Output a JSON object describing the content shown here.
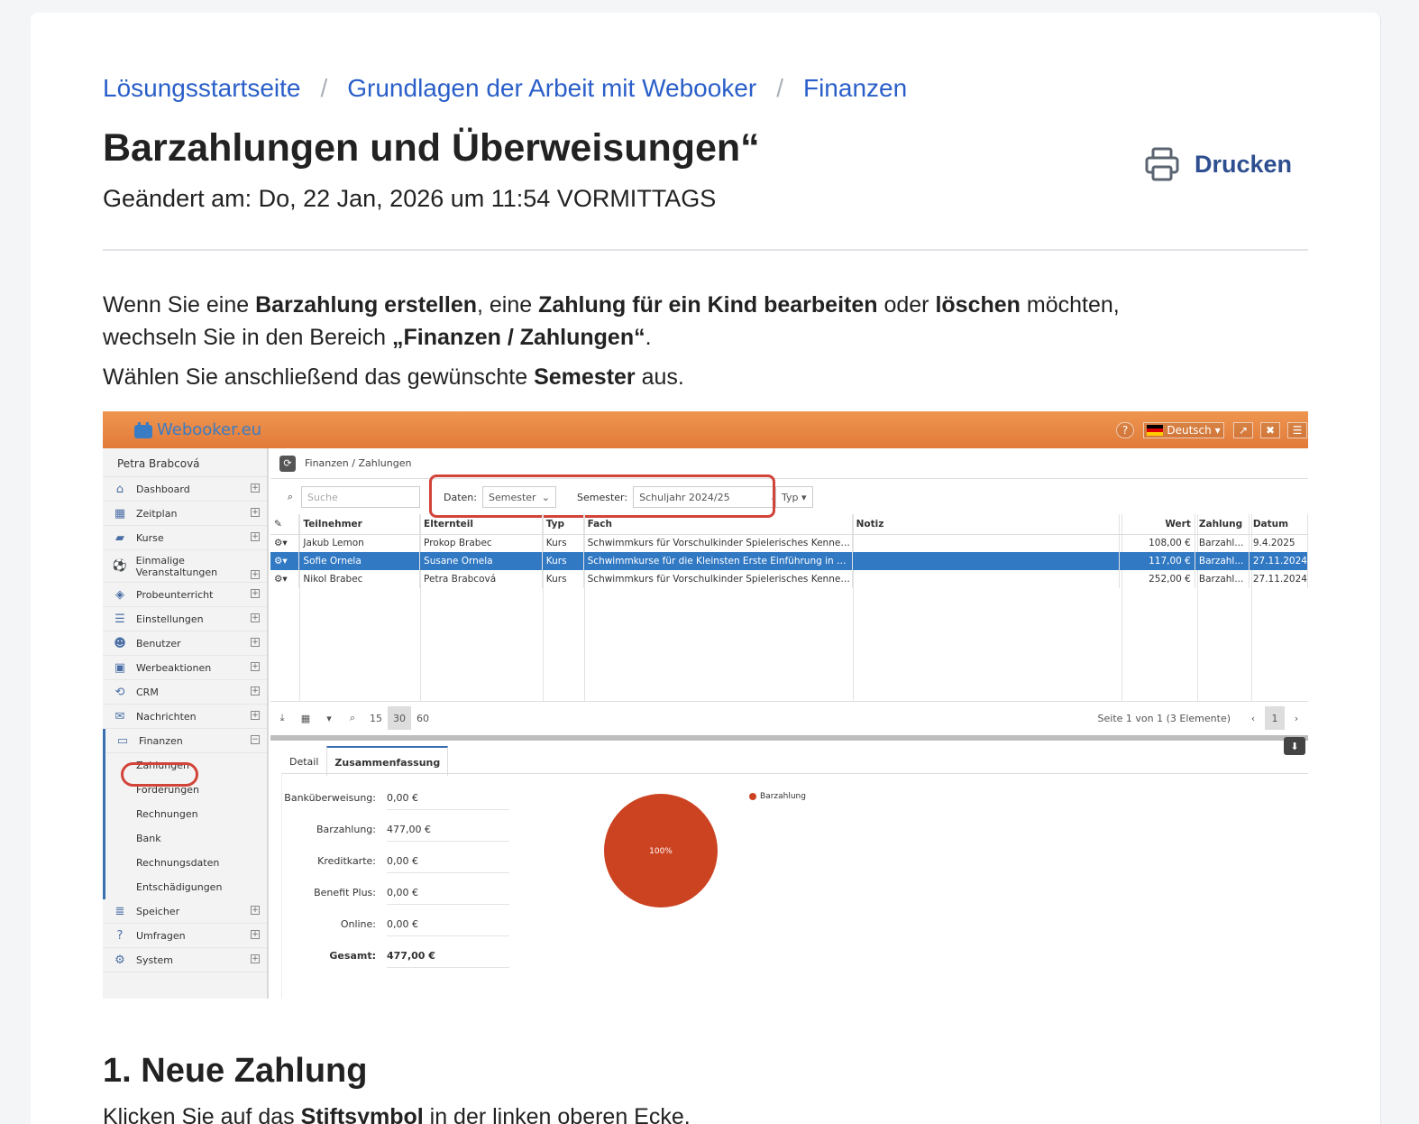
{
  "breadcrumbs": [
    "Lösungsstartseite",
    "Grundlagen der Arbeit mit Webooker",
    "Finanzen"
  ],
  "breadcrumb_separator": "/",
  "title": "Barzahlungen und Überweisungen“",
  "modified": "Geändert am: Do, 22 Jan, 2026 um 11:54 VORMITTAGS",
  "print_label": "Drucken",
  "intro": {
    "p1_a": "Wenn Sie eine ",
    "p1_b": "Barzahlung erstellen",
    "p1_c": ", eine ",
    "p1_d": "Zahlung für ein Kind bearbeiten",
    "p1_e": " oder ",
    "p1_f": "löschen",
    "p1_g": " möchten,",
    "p2_a": "wechseln Sie in den Bereich ",
    "p2_b": "„Finanzen / Zahlungen“",
    "p2_c": ".",
    "p3_a": "Wählen Sie anschließend das gewünschte ",
    "p3_b": "Semester",
    "p3_c": " aus."
  },
  "section_heading": "1. Neue Zahlung",
  "section_text_a": "Klicken Sie auf das ",
  "section_text_b": "Stiftsymbol",
  "section_text_c": " in der linken oberen Ecke.",
  "screenshot": {
    "logo": "Webooker.eu",
    "language": "Deutsch",
    "user": "Petra Brabcová",
    "nav": [
      {
        "label": "Dashboard",
        "icon": "home-icon",
        "glyph": "⌂"
      },
      {
        "label": "Zeitplan",
        "icon": "calendar-icon",
        "glyph": "▦"
      },
      {
        "label": "Kurse",
        "icon": "book-icon",
        "glyph": "▰"
      },
      {
        "label": "Einmalige Veranstaltungen",
        "icon": "soccer-icon",
        "glyph": "⚽"
      },
      {
        "label": "Probeunterricht",
        "icon": "eye-icon",
        "glyph": "◈"
      },
      {
        "label": "Einstellungen",
        "icon": "list-icon",
        "glyph": "☰"
      },
      {
        "label": "Benutzer",
        "icon": "users-icon",
        "glyph": "☻"
      },
      {
        "label": "Werbeaktionen",
        "icon": "gift-icon",
        "glyph": "▣"
      },
      {
        "label": "CRM",
        "icon": "handshake-icon",
        "glyph": "⟲"
      },
      {
        "label": "Nachrichten",
        "icon": "envelope-icon",
        "glyph": "✉"
      },
      {
        "label": "Finanzen",
        "icon": "money-icon",
        "glyph": "▭"
      }
    ],
    "finance_sub": [
      "Zahlungen",
      "Forderungen",
      "Rechnungen",
      "Bank",
      "Rechnungsdaten",
      "Entschädigungen"
    ],
    "nav_bottom": [
      {
        "label": "Speicher",
        "icon": "database-icon",
        "glyph": "≣"
      },
      {
        "label": "Umfragen",
        "icon": "question-icon",
        "glyph": "?"
      },
      {
        "label": "System",
        "icon": "cogs-icon",
        "glyph": "⚙"
      }
    ],
    "header_path": "Finanzen / Zahlungen",
    "search_placeholder": "Suche",
    "daten_label": "Daten:",
    "daten_value": "Semester",
    "semester_label": "Semester:",
    "semester_value": "Schuljahr 2024/25",
    "typ_label": "Typ",
    "columns": [
      "Teilnehmer",
      "Elternteil",
      "Typ",
      "Fach",
      "Notiz",
      "Wert",
      "Zahlung",
      "Datum"
    ],
    "rows": [
      [
        "Jakub Lemon",
        "Prokop Brabec",
        "Kurs",
        "Schwimmkurs für Vorschulkinder Spielerisches Kennenl...",
        "",
        "108,00 €",
        "Barzahl...",
        "9.4.2025"
      ],
      [
        "Sofie Ornela",
        "Susane Ornela",
        "Kurs",
        "Schwimmkurse für die Kleinsten Erste Einführung in da...",
        "",
        "117,00 €",
        "Barzahl...",
        "27.11.2024"
      ],
      [
        "Nikol Brabec",
        "Petra Brabcová",
        "Kurs",
        "Schwimmkurs für Vorschulkinder Spielerisches Kennenl...",
        "",
        "252,00 €",
        "Barzahl...",
        "27.11.2024"
      ]
    ],
    "page_sizes": [
      "15",
      "30",
      "60"
    ],
    "page_info": "Seite 1 von 1 (3 Elemente)",
    "current_page": "1",
    "tabs": [
      "Detail",
      "Zusammenfassung"
    ],
    "summary": [
      {
        "k": "Banküberweisung:",
        "v": "0,00 €"
      },
      {
        "k": "Barzahlung:",
        "v": "477,00 €"
      },
      {
        "k": "Kreditkarte:",
        "v": "0,00 €"
      },
      {
        "k": "Benefit Plus:",
        "v": "0,00 €"
      },
      {
        "k": "Online:",
        "v": "0,00 €"
      },
      {
        "k": "Gesamt:",
        "v": "477,00 €"
      }
    ],
    "pie_label": "100%",
    "legend": "Barzahlung",
    "colors": {
      "accent": "#e2823e",
      "selected": "#3279c4",
      "pie": "#cc4322",
      "highlight": "#d2443a",
      "link": "#2a5fc9"
    }
  }
}
